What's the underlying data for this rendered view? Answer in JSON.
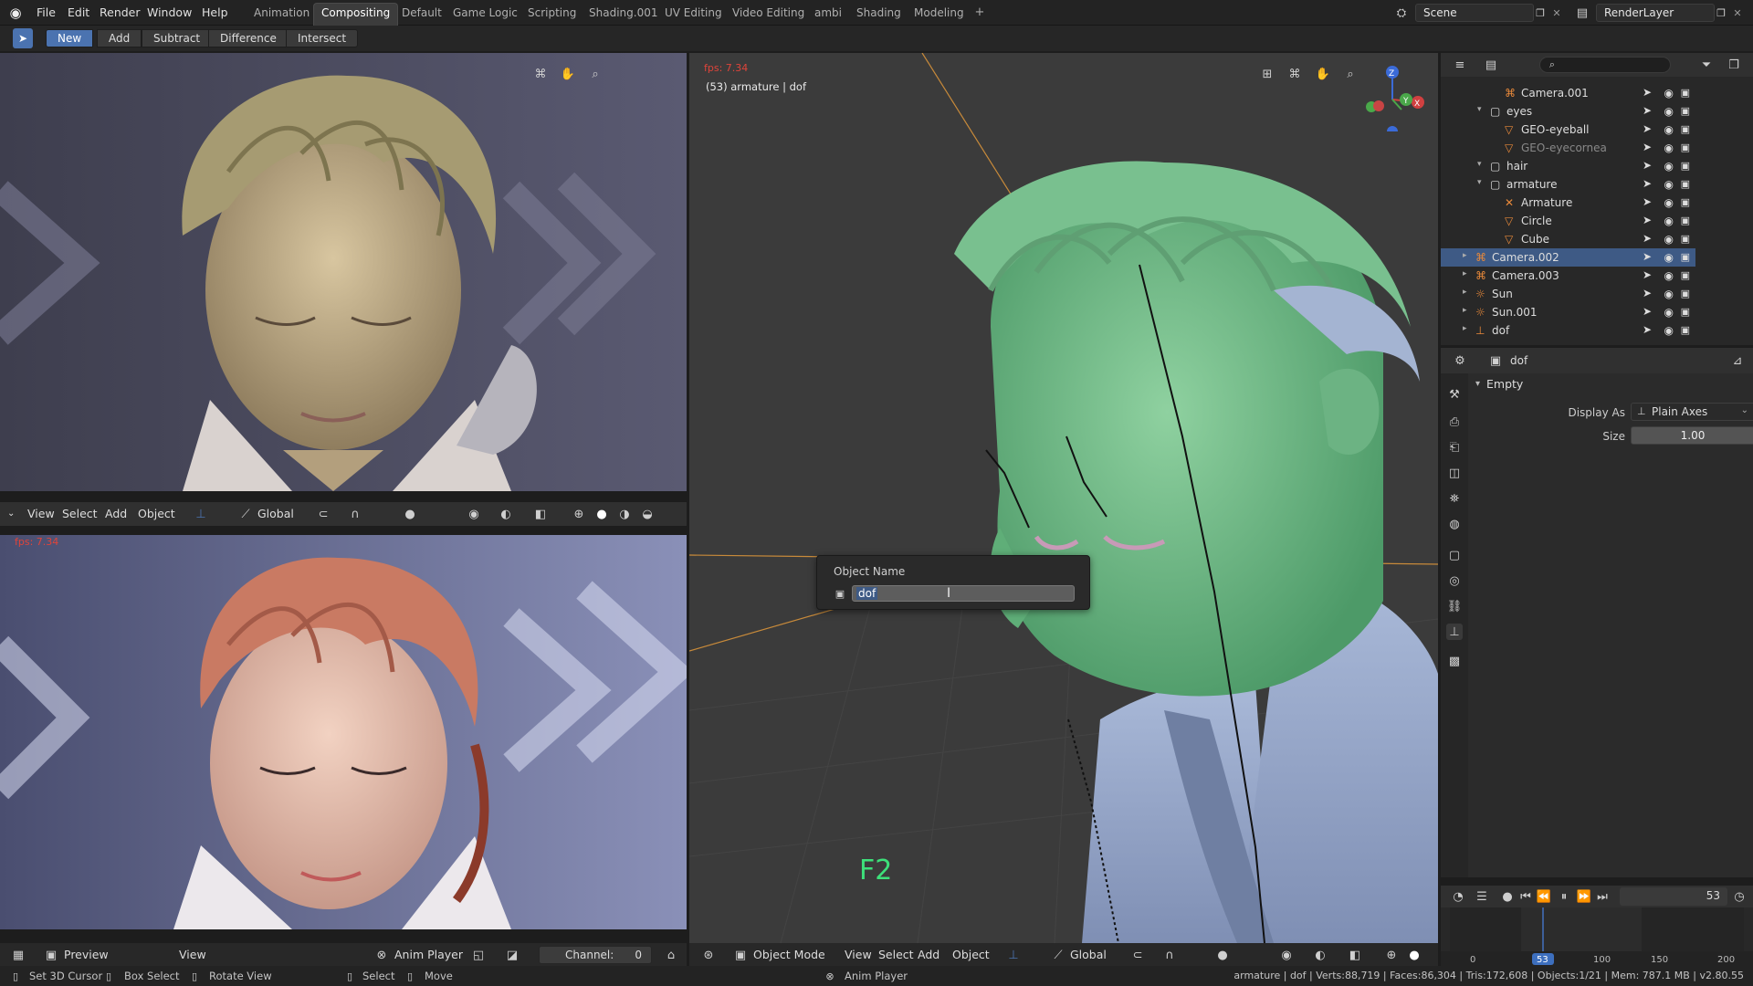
{
  "menu": [
    "File",
    "Edit",
    "Render",
    "Window",
    "Help"
  ],
  "workspaces": [
    "Animation",
    "Compositing",
    "Default",
    "Game Logic",
    "Scripting",
    "Shading.001",
    "UV Editing",
    "Video Editing",
    "ambi",
    "Shading",
    "Modeling"
  ],
  "active_workspace": "Compositing",
  "scene": "Scene",
  "render_layer": "RenderLayer",
  "bool_buttons": [
    "New",
    "Add",
    "Subtract",
    "Difference",
    "Intersect"
  ],
  "bool_active": "New",
  "left_top_fps": "fps: 7.34",
  "left_bottom_fps": "fps: 7.34",
  "left_header": {
    "view": "View",
    "select": "Select",
    "add": "Add",
    "object": "Object",
    "orientation": "Global"
  },
  "left_bottom_header": {
    "mode": "Preview",
    "view": "View",
    "anim": "Anim Player",
    "channel_label": "Channel:",
    "channel_value": "0"
  },
  "viewport": {
    "fps": "fps: 7.34",
    "info": "(53) armature | dof",
    "key_hint": "F2",
    "footer": {
      "mode": "Object Mode",
      "view": "View",
      "select": "Select",
      "add": "Add",
      "object": "Object",
      "orientation": "Global"
    },
    "gizmo": {
      "z": "Z",
      "y": "Y",
      "x": "X"
    }
  },
  "rename_popup": {
    "title": "Object Name",
    "value": "dof"
  },
  "outliner": {
    "rows": [
      {
        "label": "Camera.001",
        "indent": 3,
        "type": "camera"
      },
      {
        "label": "eyes",
        "indent": 2,
        "type": "collection"
      },
      {
        "label": "GEO-eyeball",
        "indent": 3,
        "type": "mesh"
      },
      {
        "label": "GEO-eyecornea",
        "indent": 3,
        "type": "mesh",
        "dim": true
      },
      {
        "label": "hair",
        "indent": 2,
        "type": "collection"
      },
      {
        "label": "armature",
        "indent": 2,
        "type": "collection"
      },
      {
        "label": "Armature",
        "indent": 3,
        "type": "armature"
      },
      {
        "label": "Circle",
        "indent": 3,
        "type": "mesh"
      },
      {
        "label": "Cube",
        "indent": 3,
        "type": "mesh"
      },
      {
        "label": "Camera.002",
        "indent": 1,
        "type": "camera",
        "selected": true
      },
      {
        "label": "Camera.003",
        "indent": 1,
        "type": "camera"
      },
      {
        "label": "Sun",
        "indent": 1,
        "type": "light"
      },
      {
        "label": "Sun.001",
        "indent": 1,
        "type": "light"
      },
      {
        "label": "dof",
        "indent": 1,
        "type": "empty"
      }
    ]
  },
  "properties": {
    "object_name": "dof",
    "section": "Empty",
    "display_as_label": "Display As",
    "display_as_value": "Plain Axes",
    "size_label": "Size",
    "size_value": "1.00"
  },
  "timeline": {
    "frame": "53",
    "ticks": [
      "0",
      "53",
      "100",
      "150",
      "200"
    ]
  },
  "status": {
    "items": [
      "Set 3D Cursor",
      "Box Select",
      "Rotate View",
      "Select",
      "Move"
    ],
    "center": "Anim Player",
    "right": "armature | dof | Verts:88,719 | Faces:86,304 | Tris:172,608 | Objects:1/21 | Mem: 787.1 MB | v2.80.55"
  },
  "colors": {
    "accent": "#4b73b0",
    "selection": "#3e5a85",
    "fps_red": "#e0443a"
  }
}
